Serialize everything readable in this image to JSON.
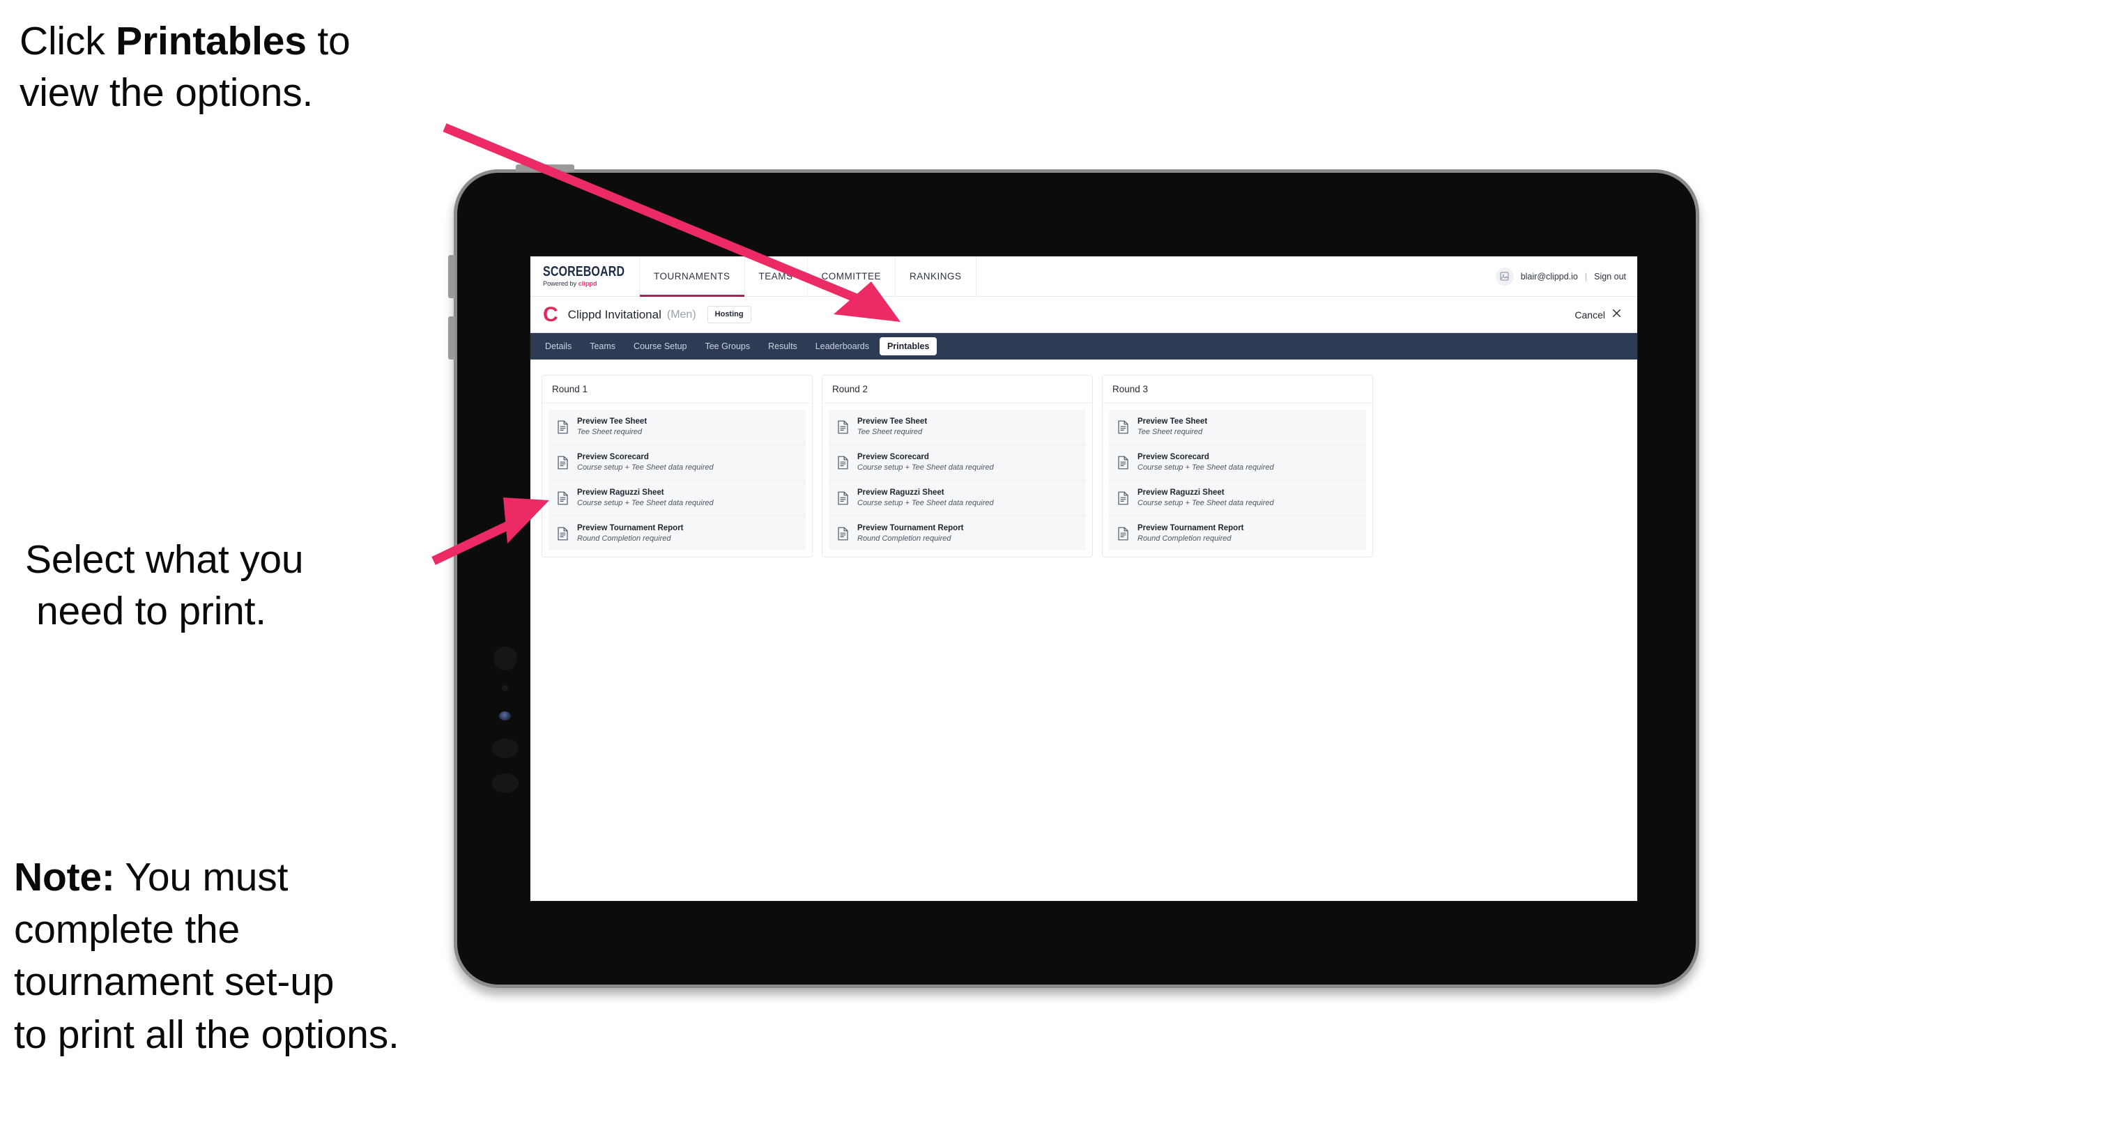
{
  "annotations": {
    "callout_1": {
      "pre": "Click ",
      "bold": "Printables",
      "post": " to",
      "line2": "view the options."
    },
    "callout_2": {
      "line1": "Select what you",
      "line2": "need to print."
    },
    "callout_3": {
      "bold": "Note:",
      "rest": " You must",
      "line2": "complete the",
      "line3": "tournament set-up",
      "line4": "to print all the options."
    }
  },
  "colors": {
    "arrow_pink": "#ec2a63",
    "tabstrip_navy": "#2d3b54",
    "brand_pink": "#e8376f",
    "active_underline": "#9c2b4e",
    "clippd_red": "#e0295c"
  },
  "app": {
    "brand": {
      "title": "SCOREBOARD",
      "powered_prefix": "Powered by ",
      "powered_brand": "clippd"
    },
    "topnav": [
      {
        "label": "TOURNAMENTS",
        "active": true
      },
      {
        "label": "TEAMS",
        "active": false
      },
      {
        "label": "COMMITTEE",
        "active": false
      },
      {
        "label": "RANKINGS",
        "active": false
      }
    ],
    "user": {
      "avatar_icon": "user-avatar-icon",
      "email": "blair@clippd.io",
      "separator": "|",
      "sign_out": "Sign out"
    },
    "tournament": {
      "logo_letter": "C",
      "name": "Clippd Invitational",
      "gender": "(Men)",
      "badge": "Hosting",
      "cancel_label": "Cancel",
      "cancel_icon": "close-icon"
    },
    "tabs": [
      {
        "label": "Details",
        "active": false
      },
      {
        "label": "Teams",
        "active": false
      },
      {
        "label": "Course Setup",
        "active": false
      },
      {
        "label": "Tee Groups",
        "active": false
      },
      {
        "label": "Results",
        "active": false
      },
      {
        "label": "Leaderboards",
        "active": false
      },
      {
        "label": "Printables",
        "active": true
      }
    ],
    "rounds": [
      {
        "title": "Round 1",
        "items": [
          {
            "icon": "document-icon",
            "title": "Preview Tee Sheet",
            "subtitle": "Tee Sheet required"
          },
          {
            "icon": "document-icon",
            "title": "Preview Scorecard",
            "subtitle": "Course setup + Tee Sheet data required"
          },
          {
            "icon": "document-icon",
            "title": "Preview Raguzzi Sheet",
            "subtitle": "Course setup + Tee Sheet data required"
          },
          {
            "icon": "document-icon",
            "title": "Preview Tournament Report",
            "subtitle": "Round Completion required"
          }
        ]
      },
      {
        "title": "Round 2",
        "items": [
          {
            "icon": "document-icon",
            "title": "Preview Tee Sheet",
            "subtitle": "Tee Sheet required"
          },
          {
            "icon": "document-icon",
            "title": "Preview Scorecard",
            "subtitle": "Course setup + Tee Sheet data required"
          },
          {
            "icon": "document-icon",
            "title": "Preview Raguzzi Sheet",
            "subtitle": "Course setup + Tee Sheet data required"
          },
          {
            "icon": "document-icon",
            "title": "Preview Tournament Report",
            "subtitle": "Round Completion required"
          }
        ]
      },
      {
        "title": "Round 3",
        "items": [
          {
            "icon": "document-icon",
            "title": "Preview Tee Sheet",
            "subtitle": "Tee Sheet required"
          },
          {
            "icon": "document-icon",
            "title": "Preview Scorecard",
            "subtitle": "Course setup + Tee Sheet data required"
          },
          {
            "icon": "document-icon",
            "title": "Preview Raguzzi Sheet",
            "subtitle": "Course setup + Tee Sheet data required"
          },
          {
            "icon": "document-icon",
            "title": "Preview Tournament Report",
            "subtitle": "Round Completion required"
          }
        ]
      }
    ]
  }
}
